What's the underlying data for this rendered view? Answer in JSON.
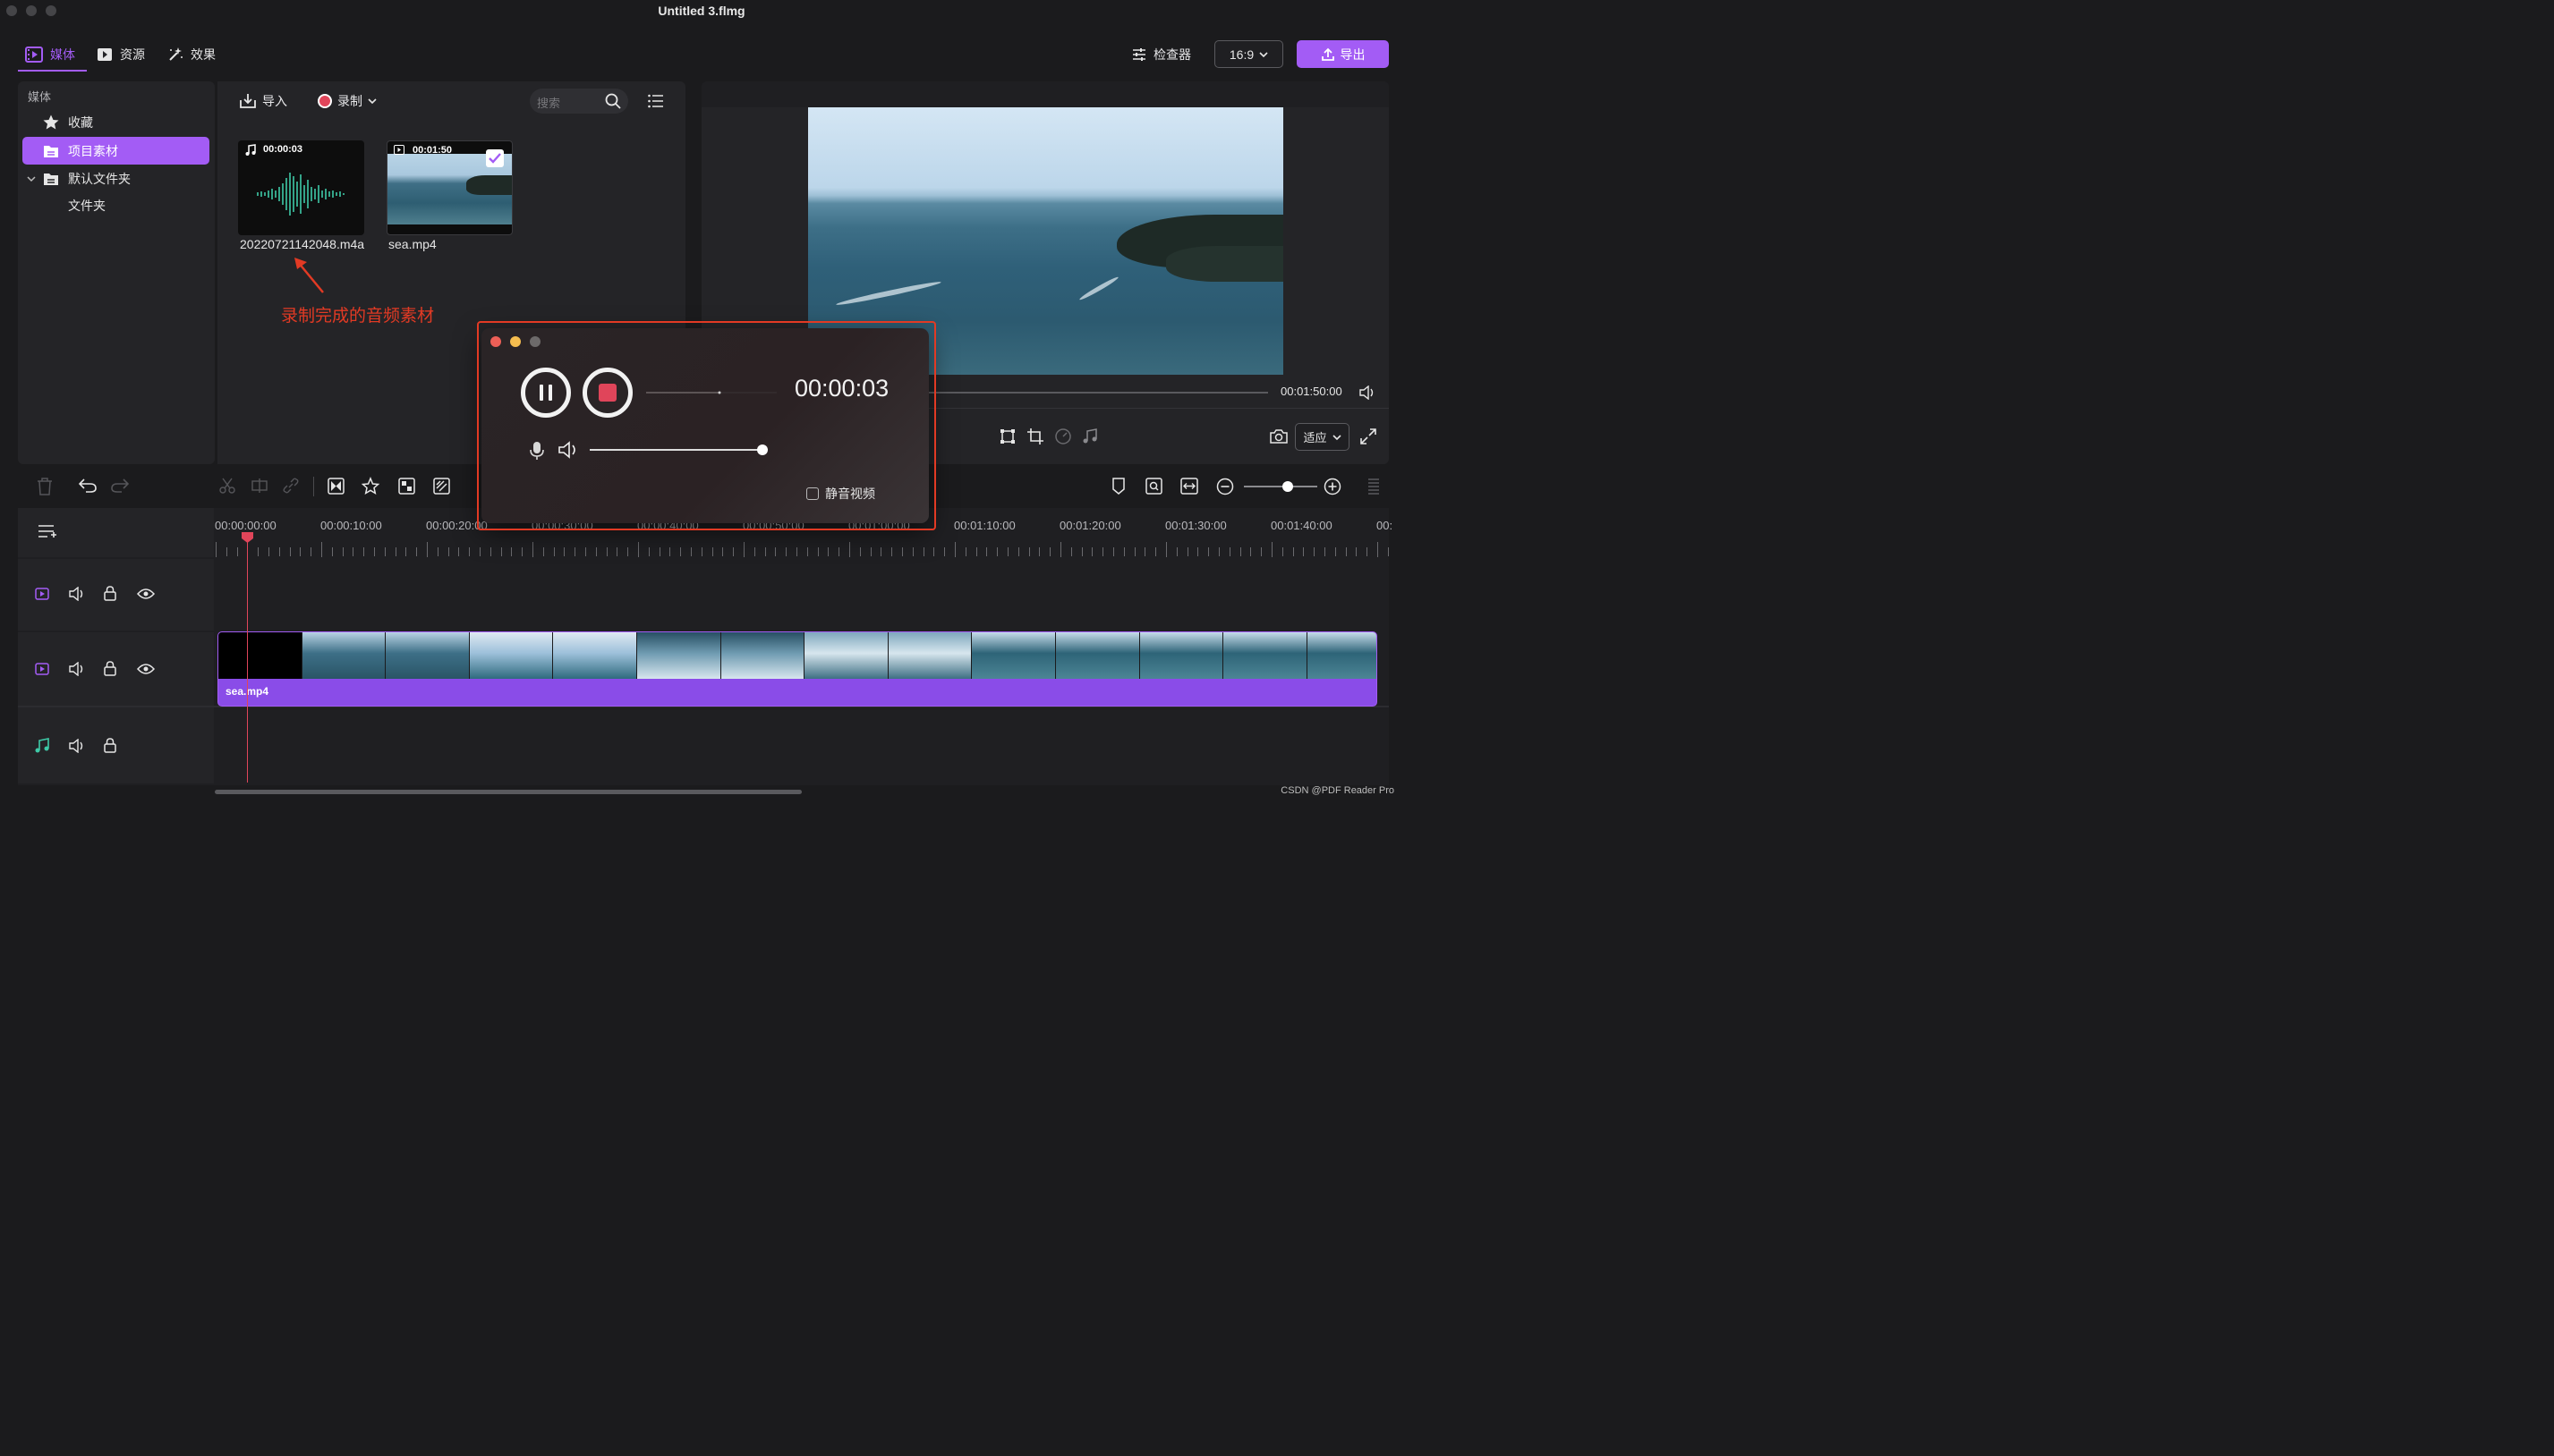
{
  "window": {
    "title": "Untitled 3.flmg"
  },
  "tabs": [
    {
      "label": "媒体",
      "icon": "film-icon",
      "active": true
    },
    {
      "label": "资源",
      "icon": "play-box-icon",
      "active": false
    },
    {
      "label": "效果",
      "icon": "magic-wand-icon",
      "active": false
    }
  ],
  "header": {
    "inspector_label": "检查器",
    "aspect_ratio": "16:9",
    "export_label": "导出"
  },
  "sidebar": {
    "title": "媒体",
    "items": [
      {
        "label": "收藏",
        "icon": "star-icon"
      },
      {
        "label": "项目素材",
        "icon": "folder-icon",
        "selected": true
      },
      {
        "label": "默认文件夹",
        "icon": "folder-icon",
        "expanded": true
      },
      {
        "label": "文件夹"
      }
    ]
  },
  "media_toolbar": {
    "import_label": "导入",
    "record_label": "录制",
    "search_placeholder": "搜索"
  },
  "media_items": [
    {
      "duration": "00:00:03",
      "name": "20220721142048.m4a",
      "type": "audio"
    },
    {
      "duration": "00:01:50",
      "name": "sea.mp4",
      "type": "video",
      "checked": true
    }
  ],
  "annotation": {
    "text": "录制完成的音频素材",
    "color": "#e23a24"
  },
  "preview": {
    "duration": "00:01:50:00",
    "fit_label": "适应"
  },
  "record_dialog": {
    "timer": "00:00:03",
    "volume": 1.0,
    "mute_label": "静音视频",
    "mute_checked": false
  },
  "timeline": {
    "ruler_labels": [
      "00:00:00:00",
      "00:00:10:00",
      "00:00:20:00",
      "00:00:30:00",
      "00:00:40:00",
      "00:00:50:00",
      "00:01:00:00",
      "00:01:10:00",
      "00:01:20:00",
      "00:01:30:00",
      "00:01:40:00",
      "00:"
    ],
    "zoom_level": 0.6,
    "clip_label": "sea.mp4"
  },
  "colors": {
    "accent": "#a35cf5",
    "record_red": "#e0455a",
    "audio_teal": "#3ec9a7"
  },
  "watermark": "CSDN @PDF Reader Pro"
}
